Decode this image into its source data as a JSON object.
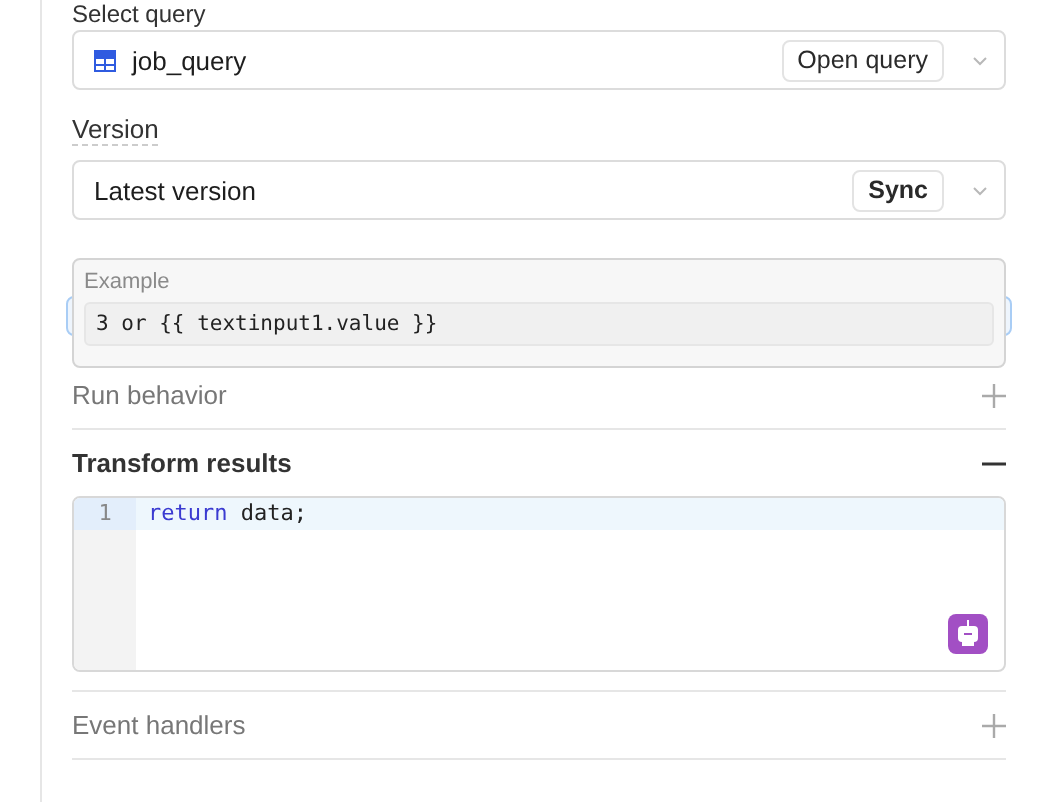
{
  "select_query": {
    "label": "Select query",
    "value": "job_query",
    "button": "Open query"
  },
  "version": {
    "label": "Version",
    "value": "Latest version",
    "button": "Sync"
  },
  "example_tooltip": {
    "title": "Example",
    "code": "3 or {{ textinput1.value }}"
  },
  "sections": [
    {
      "title": "Run behavior",
      "expanded": false
    },
    {
      "title": "Transform results",
      "expanded": true,
      "editor": {
        "lines": [
          {
            "number": "1",
            "keyword": "return",
            "rest": " data;"
          }
        ]
      }
    },
    {
      "title": "Event handlers",
      "expanded": false
    }
  ]
}
